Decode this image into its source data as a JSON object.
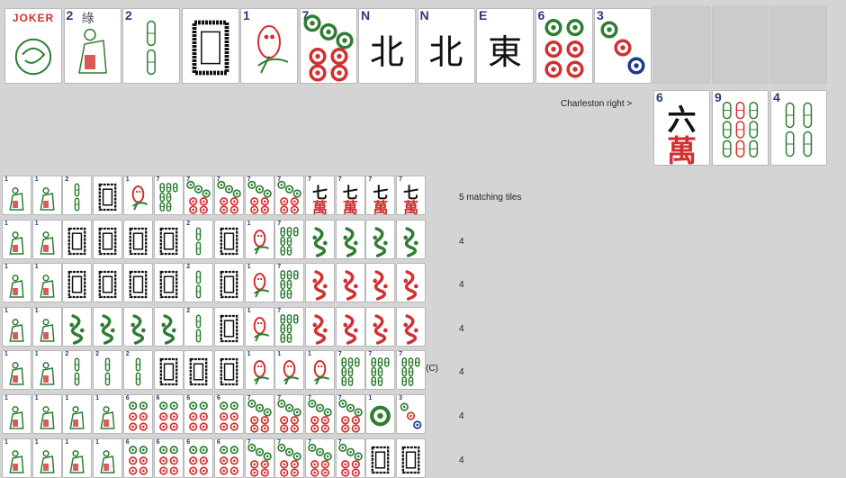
{
  "hand": [
    {
      "kind": "joker",
      "label": "JOKER"
    },
    {
      "kind": "flower",
      "num": "2",
      "extra": "綠"
    },
    {
      "kind": "bam",
      "num": "2"
    },
    {
      "kind": "soap"
    },
    {
      "kind": "bird",
      "num": "1"
    },
    {
      "kind": "dot",
      "num": "7",
      "n": 7
    },
    {
      "kind": "wind",
      "letter": "N",
      "glyph": "北"
    },
    {
      "kind": "wind",
      "letter": "N",
      "glyph": "北"
    },
    {
      "kind": "wind",
      "letter": "E",
      "glyph": "東"
    },
    {
      "kind": "dot",
      "num": "6",
      "n": 6
    },
    {
      "kind": "dot",
      "num": "3",
      "n": 3
    }
  ],
  "empty_slots": 3,
  "charleston": {
    "label": "Charleston right >",
    "tiles": [
      {
        "kind": "crak",
        "num": "6",
        "glyph": "六"
      },
      {
        "kind": "bam",
        "num": "9"
      },
      {
        "kind": "bam",
        "num": "4"
      }
    ]
  },
  "hints": {
    "rows": [
      {
        "tiles": [
          "f",
          "f",
          "b2",
          "s",
          "bird",
          "b7",
          "d7",
          "d7",
          "d7",
          "d7",
          "c7",
          "c7",
          "c7",
          "c7"
        ],
        "count": "5 matching tiles",
        "marker": ""
      },
      {
        "tiles": [
          "f",
          "f",
          "s",
          "s",
          "s",
          "s",
          "b2",
          "s",
          "bird",
          "b7",
          "g",
          "g",
          "g",
          "g"
        ],
        "count": "4",
        "marker": ""
      },
      {
        "tiles": [
          "f",
          "f",
          "s",
          "s",
          "s",
          "s",
          "b2",
          "s",
          "bird",
          "b7",
          "r",
          "r",
          "r",
          "r"
        ],
        "count": "4",
        "marker": ""
      },
      {
        "tiles": [
          "f",
          "f",
          "g",
          "g",
          "g",
          "g",
          "b2",
          "s",
          "bird",
          "b7",
          "r",
          "r",
          "r",
          "r"
        ],
        "count": "4",
        "marker": ""
      },
      {
        "tiles": [
          "f",
          "f",
          "b2",
          "b2",
          "b2",
          "s",
          "s",
          "s",
          "bird",
          "bird",
          "bird",
          "b7",
          "b7",
          "b7"
        ],
        "count": "4",
        "marker": "(C)"
      },
      {
        "tiles": [
          "f",
          "f",
          "f",
          "f",
          "d6",
          "d6",
          "d6",
          "d6",
          "d7",
          "d7",
          "d7",
          "d7",
          "d1",
          "d3"
        ],
        "count": "4",
        "marker": ""
      },
      {
        "tiles": [
          "f",
          "f",
          "f",
          "f",
          "d6",
          "d6",
          "d6",
          "d6",
          "d7",
          "d7",
          "d7",
          "d7",
          "s",
          "s"
        ],
        "count": "4",
        "marker": ""
      }
    ]
  },
  "colors": {
    "bg": "#d4d4d4",
    "green": "#2e7d32",
    "red": "#d32f2f",
    "blue": "#1a3a8a",
    "black": "#111111"
  }
}
